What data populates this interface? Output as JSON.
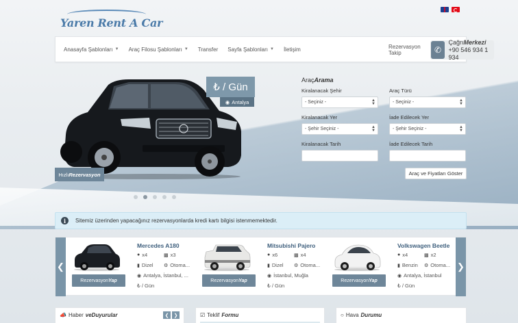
{
  "header": {
    "logo_text": "Yaren Rent A Car",
    "flags": [
      "en-flag",
      "tr-flag"
    ]
  },
  "nav": {
    "items": [
      {
        "label": "Anasayfa Şablonları",
        "dropdown": true
      },
      {
        "label": "Araç Filosu Şablonları",
        "dropdown": true
      },
      {
        "label": "Transfer",
        "dropdown": false
      },
      {
        "label": "Sayfa Şablonları",
        "dropdown": true
      },
      {
        "label": "İletişim",
        "dropdown": false
      }
    ],
    "reservation_track": "Rezervasyon Takip",
    "call_center": {
      "title_a": "Çağrı",
      "title_b": "Merkezi",
      "phone": "+90 546 934 1 934"
    }
  },
  "slider": {
    "price": "₺ / Gün",
    "location": "Antalya",
    "quick_a": "Hızlı",
    "quick_b": "Rezervasyon",
    "dots": 5,
    "active_dot": 1
  },
  "search": {
    "title_a": "Araç",
    "title_b": "Arama",
    "pickup_city_label": "Kiralanacak Şehir",
    "pickup_city_value": "- Seçiniz -",
    "car_type_label": "Araç Türü",
    "car_type_value": "- Seçiniz -",
    "pickup_place_label": "Kiralanacak Yer",
    "pickup_place_value": "- Şehir Seçiniz -",
    "return_place_label": "İade Edilecek Yer",
    "return_place_value": "- Şehir Seçiniz -",
    "pickup_date_label": "Kiralanacak Tarih",
    "return_date_label": "İade Edilecek Tarih",
    "submit": "Araç ve Fiyatları Göster"
  },
  "info": {
    "text": "Sitemiz üzerinden yapacağınız rezervasyonlarda kredi kartı bilgisi istenmemektedir."
  },
  "cars": [
    {
      "name": "Mercedes A180",
      "seats": "x4",
      "bags": "x3",
      "fuel": "Dizel",
      "gear": "Otoma...",
      "locations": "Antalya, İstanbul, ...",
      "price": "₺ / Gün",
      "btn_a": "Rezervasyon",
      "btn_b": "Yap",
      "color": "#1a1d22"
    },
    {
      "name": "Mitsubishi Pajero",
      "seats": "x6",
      "bags": "x4",
      "fuel": "Dizel",
      "gear": "Otoma...",
      "locations": "İstanbul, Muğla",
      "price": "₺ / Gün",
      "btn_a": "Rezervasyon",
      "btn_b": "Yap",
      "color": "#e8e8e6"
    },
    {
      "name": "Volkswagen Beetle",
      "seats": "x4",
      "bags": "x2",
      "fuel": "Benzin",
      "gear": "Otoma...",
      "locations": "Antalya, İstanbul",
      "price": "₺ / Gün",
      "btn_a": "Rezervasyon",
      "btn_b": "Yap",
      "color": "#f2f2f2"
    }
  ],
  "panels": {
    "news_a": "Haber",
    "news_b": "ve",
    "news_c": "Duyurular",
    "offer_a": "Teklif",
    "offer_b": "Formu",
    "weather_a": "Hava",
    "weather_b": "Durumu"
  },
  "colors": {
    "accent": "#7a95a8",
    "brand": "#4a7aa8",
    "info_bg": "#dbeef7"
  }
}
